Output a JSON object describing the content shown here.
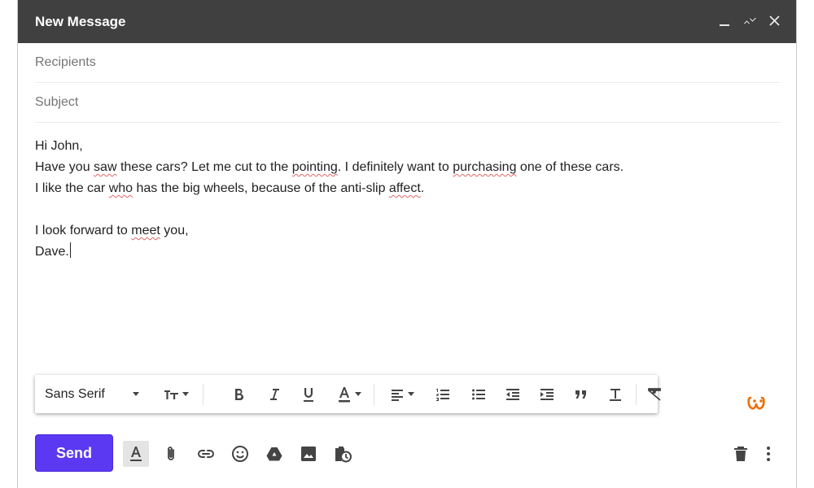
{
  "window": {
    "title": "New Message",
    "controls": [
      "minimize-icon",
      "expand-icon",
      "close-icon"
    ]
  },
  "recipients": {
    "placeholder": "Recipients",
    "value": ""
  },
  "subject": {
    "placeholder": "Subject",
    "value": ""
  },
  "body": {
    "greeting": "Hi John,",
    "line1": [
      {
        "t": "Have you "
      },
      {
        "t": "saw",
        "s": true
      },
      {
        "t": " these cars? Let me cut to the "
      },
      {
        "t": "pointing",
        "s": true
      },
      {
        "t": ". I definitely want to "
      },
      {
        "t": "purchasing",
        "s": true
      },
      {
        "t": " one of these cars."
      }
    ],
    "line2": [
      {
        "t": "I like the car "
      },
      {
        "t": "who",
        "s": true
      },
      {
        "t": " has the big wheels, because of the anti-slip "
      },
      {
        "t": "affect",
        "s": true
      },
      {
        "t": "."
      }
    ],
    "line3": [
      {
        "t": "I look forward to "
      },
      {
        "t": "meet",
        "s": true
      },
      {
        "t": " you,"
      }
    ],
    "signoff": "Dave."
  },
  "formatting": {
    "font": "Sans Serif",
    "tools": [
      "font-size",
      "bold",
      "italic",
      "underline",
      "text-color",
      "align",
      "numbered-list",
      "bulleted-list",
      "indent-less",
      "indent-more",
      "quote",
      "strikethrough",
      "remove-formatting"
    ]
  },
  "actions": {
    "send_label": "Send",
    "icons": [
      "formatting-options-icon",
      "attach-icon",
      "link-icon",
      "emoji-icon",
      "drive-icon",
      "photo-icon",
      "confidential-icon",
      "trash-icon",
      "more-icon"
    ]
  },
  "colors": {
    "titlebar": "#404040",
    "send": "#5b39f2",
    "spelling": "#e06666",
    "logo": "#ef6c00"
  }
}
